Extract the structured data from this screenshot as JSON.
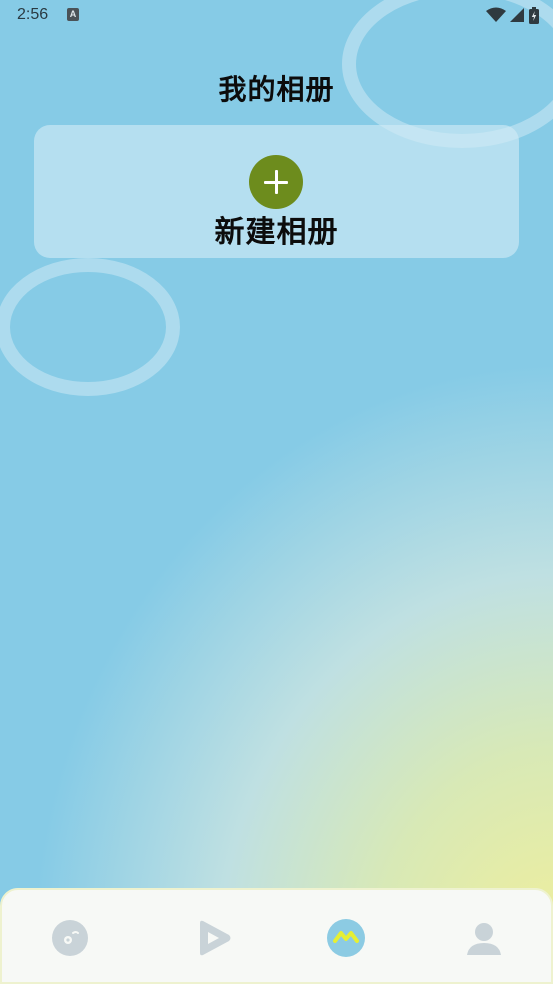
{
  "status_bar": {
    "time": "2:56",
    "notification_icon": "A",
    "icons": [
      "wifi-icon",
      "cellular-signal-icon",
      "battery-icon"
    ]
  },
  "page": {
    "title": "我的相册"
  },
  "new_album": {
    "label": "新建相册",
    "icon": "plus-icon",
    "icon_bg_color": "#6d8c1d"
  },
  "bottom_nav": {
    "items": [
      {
        "icon": "disc-icon",
        "active": false
      },
      {
        "icon": "play-icon",
        "active": false
      },
      {
        "icon": "album-icon",
        "active": true
      },
      {
        "icon": "user-icon",
        "active": false
      }
    ],
    "active_color": "#8ccbe3",
    "inactive_color": "#c9d3d8"
  },
  "colors": {
    "background_top": "#86cbe6",
    "background_glow": "#f1ef9a"
  }
}
